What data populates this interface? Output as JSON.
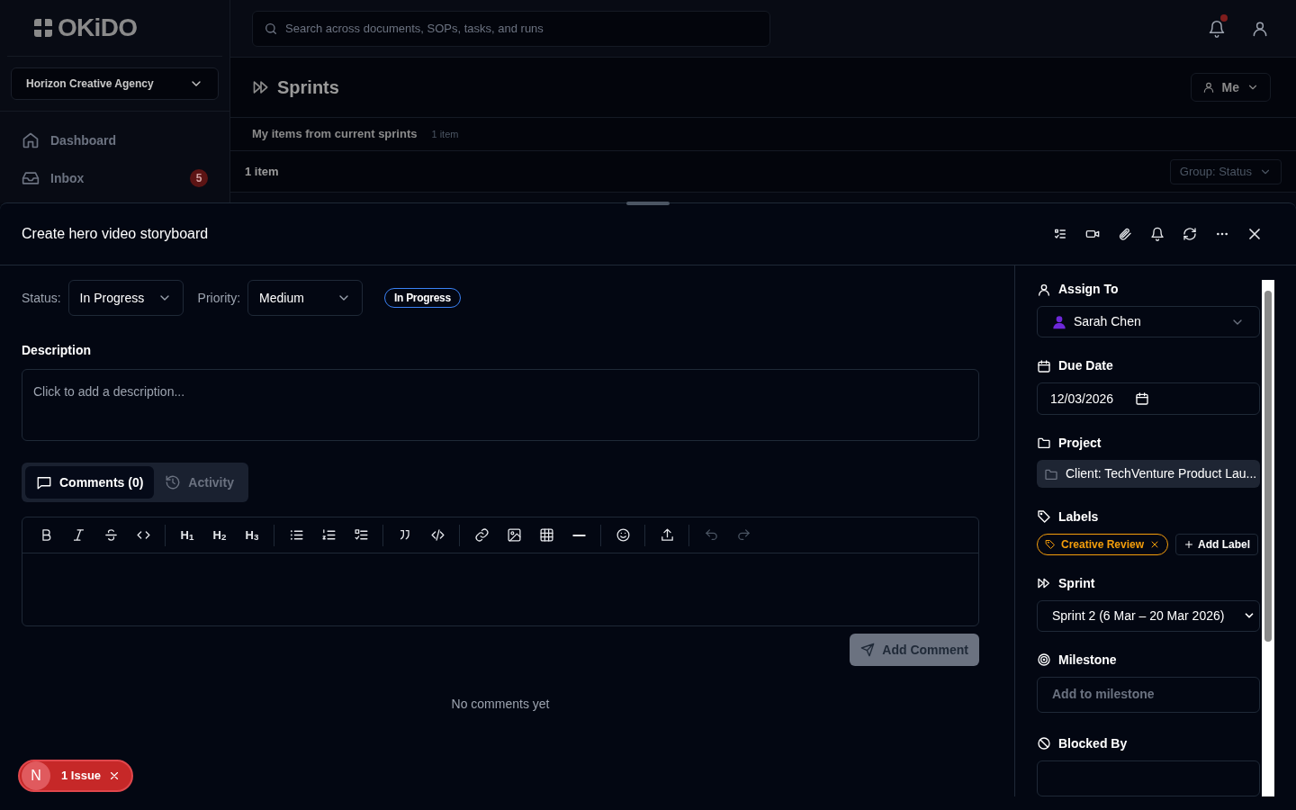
{
  "logo": "OKiDO",
  "search": {
    "placeholder": "Search across documents, SOPs, tasks, and runs"
  },
  "notifications": {
    "unread": true
  },
  "workspace": "Horizon Creative Agency",
  "nav": [
    {
      "kind": "home",
      "label": "Dashboard"
    },
    {
      "kind": "inbox",
      "label": "Inbox",
      "badge": "5"
    }
  ],
  "page": {
    "title": "Sprints",
    "filter": "Me",
    "section": "My items from current sprints",
    "section_count": "1 item",
    "group_count": "1 item",
    "group_by": "Group: Status"
  },
  "task": {
    "title": "Create hero video storyboard",
    "status_label": "Status:",
    "status": "In Progress",
    "priority_label": "Priority:",
    "priority": "Medium",
    "status_badge": "In Progress",
    "description_heading": "Description",
    "description_placeholder": "Click to add a description...",
    "tabs": [
      {
        "kind": "comments",
        "label": "Comments (0)",
        "selected": true
      },
      {
        "kind": "activity",
        "label": "Activity",
        "selected": false
      }
    ],
    "headings": [
      "H$_{1}$",
      "H$_{2}$",
      "H$_{3}$"
    ],
    "add_comment": "Add Comment",
    "empty": "No comments yet"
  },
  "details": {
    "assign_label": "Assign To",
    "assignee": "Sarah Chen",
    "due_label": "Due Date",
    "due": "12/03/2026",
    "project_label": "Project",
    "project": "Client: TechVenture Product Lau...",
    "labels_label": "Labels",
    "labels": [
      {
        "label": "Creative Review",
        "color": "#f59e0b"
      }
    ],
    "add_label": "Add Label",
    "sprint_label": "Sprint",
    "sprint": "Sprint 2 (6 Mar – 20 Mar 2026)",
    "milestone_label": "Milestone",
    "milestone_placeholder": "Add to milestone",
    "blocked_label": "Blocked By"
  },
  "issues": {
    "avatar": "N",
    "label": "1 Issue"
  }
}
